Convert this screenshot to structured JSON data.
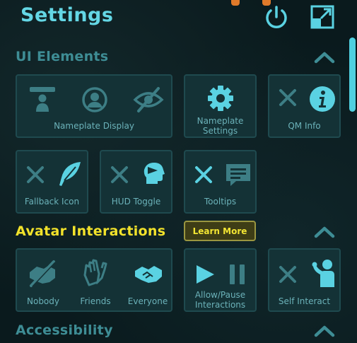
{
  "header": {
    "title": "Settings"
  },
  "sections": {
    "ui": {
      "title": "UI Elements"
    },
    "avatar": {
      "title": "Avatar Interactions",
      "learn_more": "Learn More"
    },
    "accessibility": {
      "title": "Accessibility"
    }
  },
  "ui_cards": {
    "nameplate_display": "Nameplate Display",
    "nameplate_settings": "Nameplate Settings",
    "qm_info": "QM Info",
    "fallback_icon": "Fallback Icon",
    "hud_toggle": "HUD Toggle",
    "tooltips": "Tooltips"
  },
  "avatar_cards": {
    "nobody": "Nobody",
    "friends": "Friends",
    "everyone": "Everyone",
    "allow_pause": "Allow/Pause Interactions",
    "self_interact": "Self Interact"
  },
  "colors": {
    "accent": "#64d7e5",
    "highlight": "#f2e22b",
    "card_bg": "#143236",
    "icon_dim": "#3d7e85",
    "icon_bright": "#5ad2e2"
  }
}
